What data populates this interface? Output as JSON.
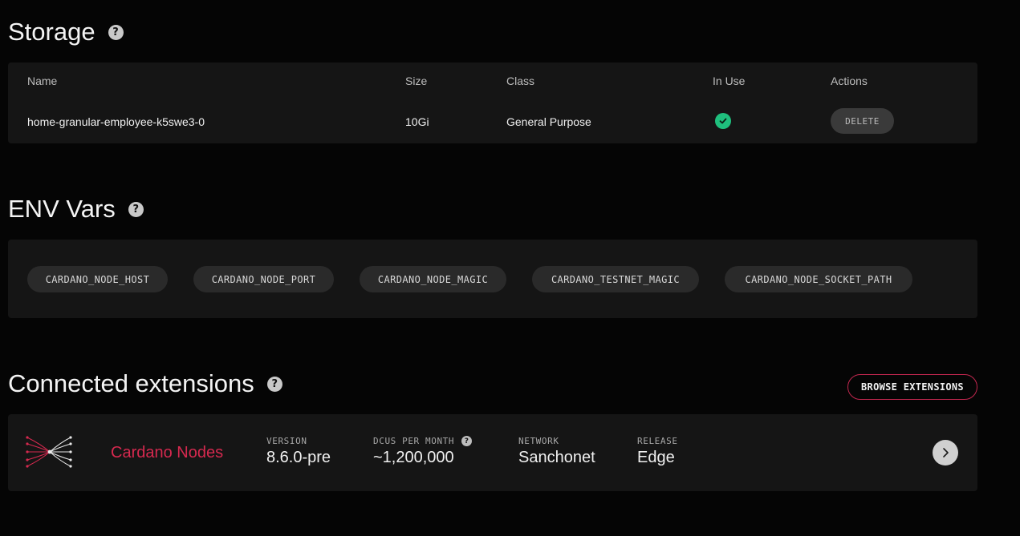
{
  "storage": {
    "title": "Storage",
    "help": "?",
    "columns": [
      "Name",
      "Size",
      "Class",
      "In Use",
      "Actions"
    ],
    "rows": [
      {
        "name": "home-granular-employee-k5swe3-0",
        "size": "10Gi",
        "class": "General Purpose",
        "in_use": true,
        "action": "DELETE"
      }
    ]
  },
  "env": {
    "title": "ENV Vars",
    "help": "?",
    "vars": [
      "CARDANO_NODE_HOST",
      "CARDANO_NODE_PORT",
      "CARDANO_NODE_MAGIC",
      "CARDANO_TESTNET_MAGIC",
      "CARDANO_NODE_SOCKET_PATH"
    ]
  },
  "extensions": {
    "title": "Connected extensions",
    "help": "?",
    "browse_label": "BROWSE EXTENSIONS",
    "items": [
      {
        "name": "Cardano Nodes",
        "logo_icon": "cardano-nodes-logo-icon",
        "version_label": "VERSION",
        "version": "8.6.0-pre",
        "dcus_label": "DCUS PER MONTH",
        "dcus_help": "?",
        "dcus": "~1,200,000",
        "network_label": "NETWORK",
        "network": "Sanchonet",
        "release_label": "RELEASE",
        "release": "Edge"
      }
    ]
  },
  "colors": {
    "background": "#050505",
    "card": "#151515",
    "accent": "#d6294f",
    "success": "#1fbf7d"
  }
}
